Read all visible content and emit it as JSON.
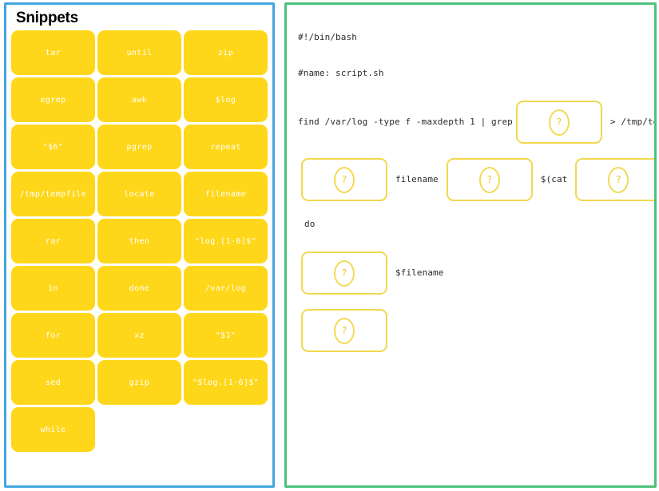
{
  "colors": {
    "snippet_panel_border": "#43a6e0",
    "script_panel_border": "#4cc27a",
    "snippet_tile_bg": "#ffd71a",
    "snippet_tile_text": "#ffffff",
    "drop_zone_border": "#f0d84e",
    "drop_zone_qmark": "#e8c92c",
    "code_text": "#2b2b2b"
  },
  "snippets": {
    "title": "Snippets",
    "tiles": [
      {
        "label": "tar"
      },
      {
        "label": "until"
      },
      {
        "label": "zip"
      },
      {
        "label": "egrep"
      },
      {
        "label": "awk"
      },
      {
        "label": "$log"
      },
      {
        "label": "\"$6\""
      },
      {
        "label": "pgrep"
      },
      {
        "label": "repeat"
      },
      {
        "label": "/tmp/tempfile"
      },
      {
        "label": "locate"
      },
      {
        "label": "filename"
      },
      {
        "label": "rar"
      },
      {
        "label": "then"
      },
      {
        "label": "\"log.[1-6]$\""
      },
      {
        "label": "in"
      },
      {
        "label": "done"
      },
      {
        "label": "/var/log"
      },
      {
        "label": "for"
      },
      {
        "label": "xz"
      },
      {
        "label": "\"$1\""
      },
      {
        "label": "sed"
      },
      {
        "label": "gzip"
      },
      {
        "label": "\"$log.[1-6]$\""
      },
      {
        "label": "while"
      }
    ]
  },
  "script": {
    "line1": "#!/bin/bash",
    "line2": "#name: script.sh",
    "line3_pre": "find /var/log -type f -maxdepth 1 | grep",
    "line3_post": "> /tmp/tempfile",
    "line4_mid": "filename",
    "line4_cat": "$(cat",
    "line4_close": ")",
    "line5": "do",
    "line6_post": "$filename",
    "drop_placeholder": "?"
  }
}
